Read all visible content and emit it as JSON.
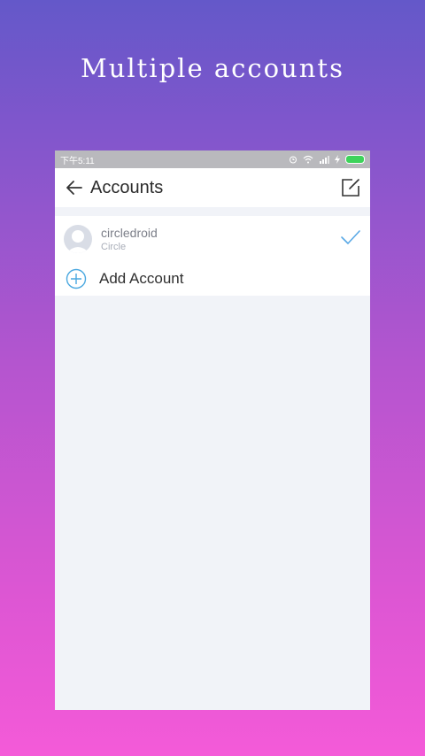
{
  "promo": {
    "headline": "Multiple accounts"
  },
  "status_bar": {
    "time": "下午5:11"
  },
  "app_bar": {
    "title": "Accounts"
  },
  "accounts": [
    {
      "name": "circledroid",
      "subtitle": "Circle",
      "selected": true
    }
  ],
  "add_account": {
    "label": "Add Account"
  },
  "colors": {
    "accent_check": "#5aa9e6",
    "add_icon": "#4aa8e0",
    "battery": "#3ed35b",
    "background_top": "#6458c9",
    "background_bottom": "#f45ad8"
  }
}
